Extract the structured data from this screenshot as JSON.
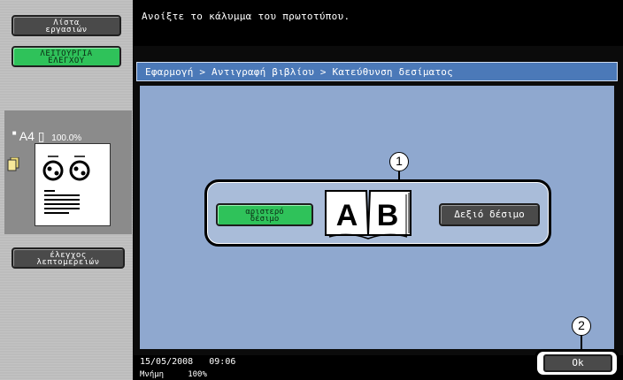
{
  "sidebar": {
    "jobs_button": "Λίστα\nεργασιών",
    "function_button": "ΛΕΙΤΟΥΡΓΙΑ\nΕΛΕΓΧΟΥ",
    "status": {
      "paper": "A4",
      "zoom": "100.0%"
    },
    "detail_button": "έλεγχος\nλεπτομερειών"
  },
  "message": "Ανοίξτε το κάλυμμα του πρωτοτύπου.",
  "breadcrumb": "Εφαρμογή > Αντιγραφή βιβλίου > Κατεύθυνση δεσίματος",
  "binding": {
    "left_button": "αριστερό\nδέσιμο",
    "right_button": "Δεξιό δέσιμο",
    "book_letters": [
      "A",
      "B"
    ]
  },
  "callouts": [
    "1",
    "2"
  ],
  "footer": {
    "date": "15/05/2008   09:06",
    "memory_label": "Μνήμη",
    "memory_value": "100%",
    "ok_button": "Ok"
  },
  "colors": {
    "accent_green": "#2fc25a",
    "panel_blue": "#8fa8cf",
    "path_blue": "#4b79b8"
  }
}
